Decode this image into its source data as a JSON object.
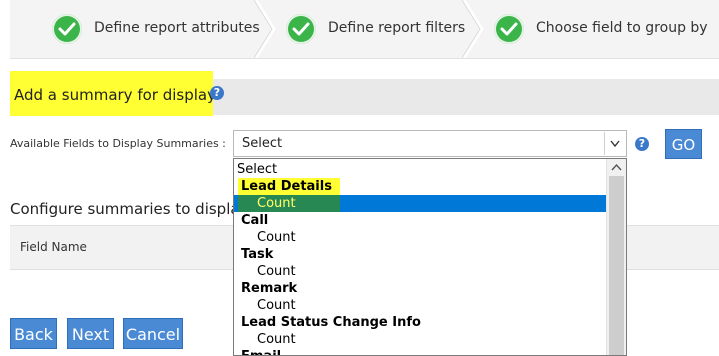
{
  "wizard": {
    "steps": [
      {
        "label": "Define report attributes"
      },
      {
        "label": "Define report filters"
      },
      {
        "label": "Choose field to group by"
      }
    ]
  },
  "section": {
    "title": "Add a summary for display",
    "help": "?"
  },
  "available_fields": {
    "label": "Available Fields to Display Summaries :",
    "selected_value": "Select",
    "help": "?",
    "go_label": "GO"
  },
  "dropdown": {
    "options": [
      {
        "text": "Select",
        "kind": "plain"
      },
      {
        "text": "Lead Details",
        "kind": "group"
      },
      {
        "text": "Count",
        "kind": "child",
        "selected": true
      },
      {
        "text": "Call",
        "kind": "group"
      },
      {
        "text": "Count",
        "kind": "child"
      },
      {
        "text": "Task",
        "kind": "group"
      },
      {
        "text": "Count",
        "kind": "child"
      },
      {
        "text": "Remark",
        "kind": "group"
      },
      {
        "text": "Count",
        "kind": "child"
      },
      {
        "text": "Lead Status Change Info",
        "kind": "group"
      },
      {
        "text": "Count",
        "kind": "child"
      },
      {
        "text": "Email",
        "kind": "group"
      }
    ]
  },
  "configure": {
    "title": "Configure summaries to display",
    "column_header": "Field Name"
  },
  "buttons": {
    "back": "Back",
    "next": "Next",
    "cancel": "Cancel"
  },
  "colors": {
    "accent": "#4a8ad4",
    "check": "#3bb44a",
    "highlight": "#ffff33",
    "selected": "#0078d7"
  }
}
